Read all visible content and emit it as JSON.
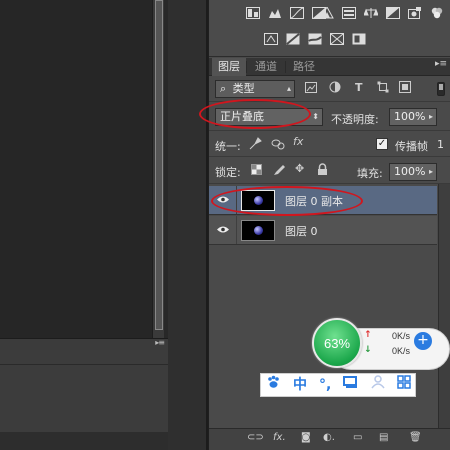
{
  "layers_panel": {
    "tabs": [
      {
        "label": "图层",
        "active": true
      },
      {
        "label": "通道",
        "active": false
      },
      {
        "label": "路径",
        "active": false
      }
    ],
    "filter": {
      "search_icon": "search-icon",
      "kind_label": "类型"
    },
    "blend_mode": "正片叠底",
    "opacity_label": "不透明度:",
    "opacity_value": "100%",
    "unify_label": "统一:",
    "propagate_frame_label": "传播帧",
    "propagate_frame_value": "1",
    "propagate_checked": true,
    "lock_label": "锁定:",
    "fill_label": "填充:",
    "fill_value": "100%",
    "layers": [
      {
        "name": "图层 0 副本",
        "selected": true,
        "visible": true
      },
      {
        "name": "图层 0",
        "selected": false,
        "visible": true
      }
    ]
  },
  "speed_widget": {
    "percent": "63%",
    "up_rate": "0K/s",
    "down_rate": "0K/s",
    "ball_color": "#1aa64a",
    "up_arrow_color": "#e03030",
    "down_arrow_color": "#2a9a40"
  },
  "ime_toolbar": {
    "icons": [
      "paw-icon",
      "chinese-mode",
      "punctuation-icon",
      "keyboard-icon",
      "user-icon",
      "grid-icon"
    ],
    "chinese_mode_label": "中",
    "punct_label": "°,"
  },
  "colors": {
    "annotation": "#d0161e",
    "selected_layer": "#596983",
    "panel_bg": "#4a4a4a"
  }
}
